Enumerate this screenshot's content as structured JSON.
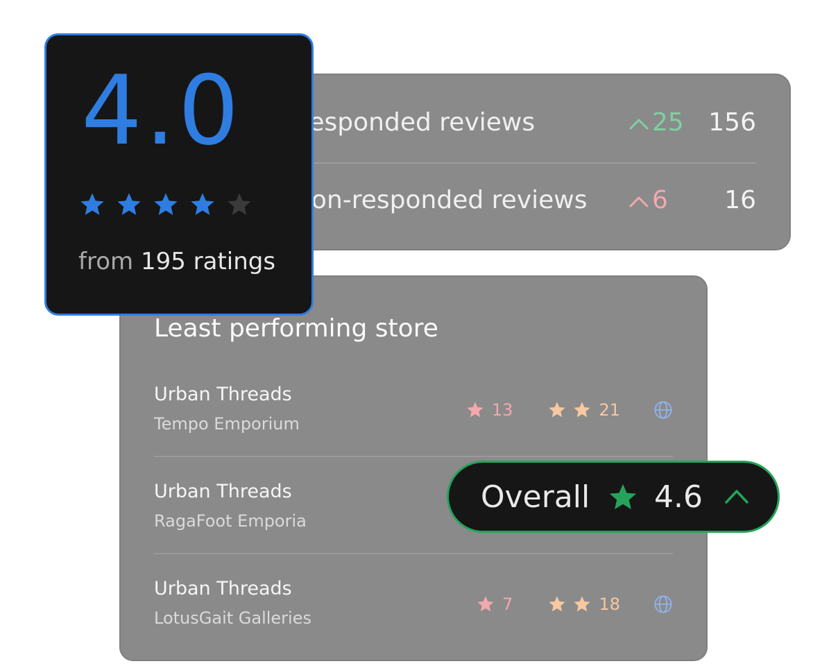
{
  "responses": {
    "rows": [
      {
        "label": "Responded reviews",
        "trend_value": "25",
        "count": "156",
        "trend_color": "#7fd0a0"
      },
      {
        "label": "Non-responded reviews",
        "trend_value": "6",
        "count": "16",
        "trend_color": "#f2a9ad"
      }
    ]
  },
  "rating": {
    "value": "4.0",
    "stars_filled": 4,
    "stars_total": 5,
    "from_prefix": "from",
    "ratings_text": "195 ratings",
    "accent": "#2f7de1"
  },
  "least": {
    "title": "Least performing store",
    "stores": [
      {
        "name": "Urban Threads",
        "sub": "Tempo Emporium",
        "one_star": "13",
        "two_star": "21",
        "icon": "globe-icon"
      },
      {
        "name": "Urban Threads",
        "sub": "RagaFoot Emporia",
        "one_star": "",
        "two_star": "",
        "icon": ""
      },
      {
        "name": "Urban Threads",
        "sub": "LotusGait Galleries",
        "one_star": "7",
        "two_star": "18",
        "icon": "globe-icon"
      }
    ]
  },
  "overall": {
    "label": "Overall",
    "value": "4.6",
    "accent": "#25a35a"
  }
}
